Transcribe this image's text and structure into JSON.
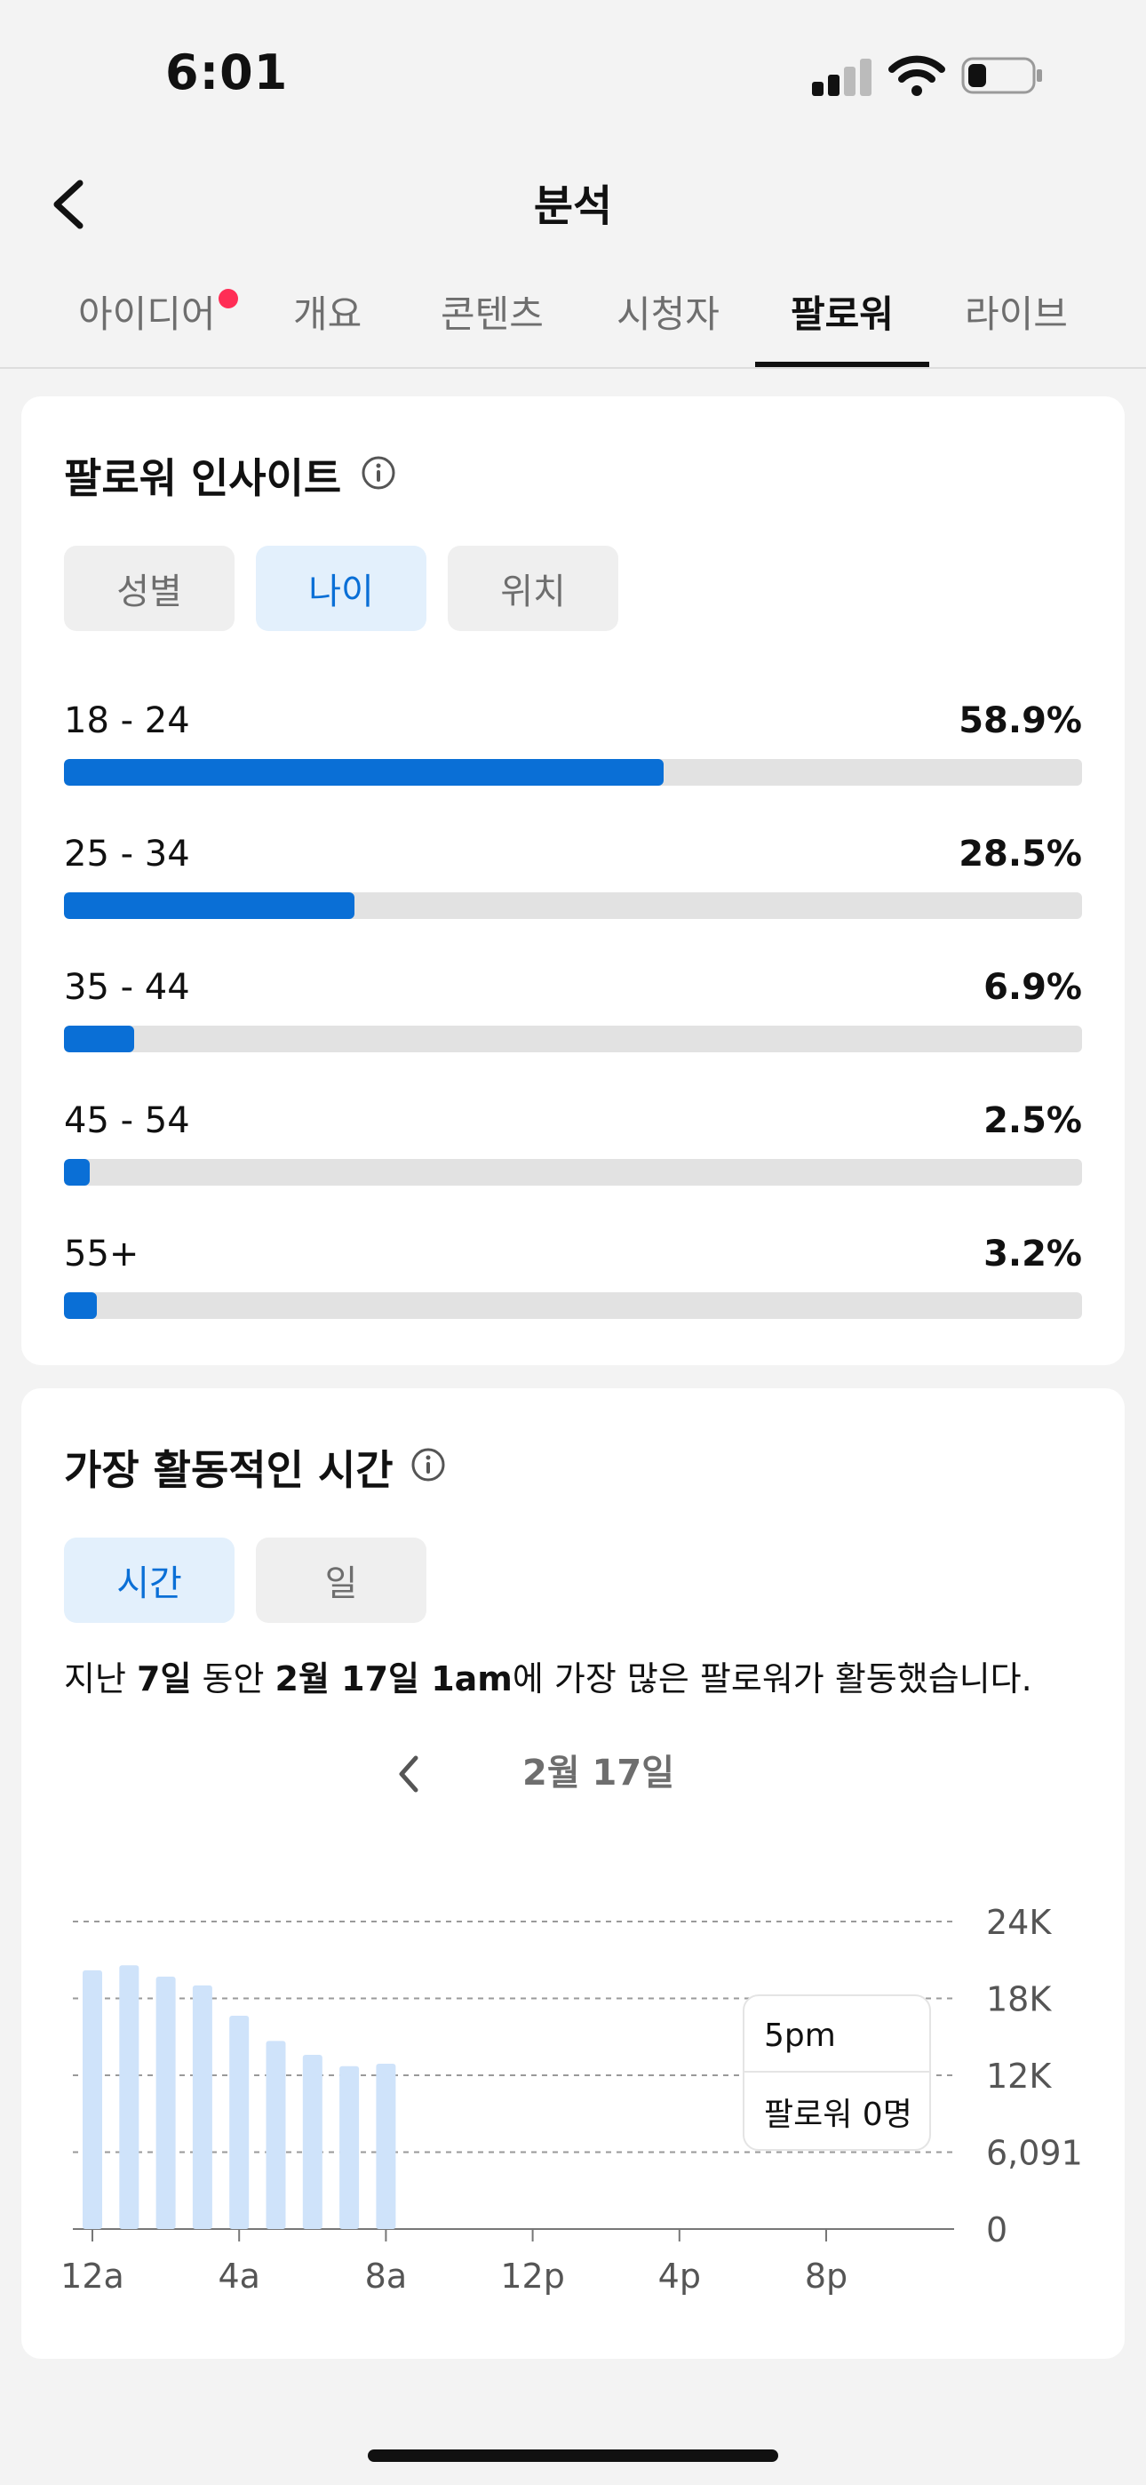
{
  "status_bar": {
    "time": "6:01"
  },
  "nav": {
    "title": "분석"
  },
  "tabs": [
    {
      "label": "아이디어",
      "active": false,
      "has_notification": true
    },
    {
      "label": "개요",
      "active": false
    },
    {
      "label": "콘텐츠",
      "active": false
    },
    {
      "label": "시청자",
      "active": false
    },
    {
      "label": "팔로워",
      "active": true
    },
    {
      "label": "라이브",
      "active": false
    }
  ],
  "follower_insights": {
    "title": "팔로워 인사이트",
    "filters": [
      {
        "label": "성별",
        "active": false
      },
      {
        "label": "나이",
        "active": true
      },
      {
        "label": "위치",
        "active": false
      }
    ],
    "age_groups": [
      {
        "label": "18 - 24",
        "percent": "58.9%",
        "fraction": 0.589
      },
      {
        "label": "25 - 34",
        "percent": "28.5%",
        "fraction": 0.285
      },
      {
        "label": "35 - 44",
        "percent": "6.9%",
        "fraction": 0.069
      },
      {
        "label": "45 - 54",
        "percent": "2.5%",
        "fraction": 0.025
      },
      {
        "label": "55+",
        "percent": "3.2%",
        "fraction": 0.032
      }
    ]
  },
  "active_times": {
    "title": "가장 활동적인 시간",
    "filters": [
      {
        "label": "시간",
        "active": true
      },
      {
        "label": "일",
        "active": false
      }
    ],
    "summary_prefix": "지난 ",
    "summary_days": "7일",
    "summary_mid": " 동안 ",
    "summary_date": "2월 17일 1am",
    "summary_suffix": "에 가장 많은 팔로워가 활동했습니다.",
    "date_label": "2월 17일",
    "tooltip": {
      "time": "5pm",
      "value": "팔로워 0명"
    }
  },
  "chart_data": {
    "type": "bar",
    "categories": [
      "12a",
      "1a",
      "2a",
      "3a",
      "4a",
      "5a",
      "6a",
      "7a",
      "8a",
      "9a",
      "10a",
      "11a",
      "12p",
      "1p",
      "2p",
      "3p",
      "4p",
      "5p",
      "6p",
      "7p",
      "8p",
      "9p",
      "10p",
      "11p"
    ],
    "x_tick_labels": [
      "12a",
      "4a",
      "8a",
      "12p",
      "4p",
      "8p"
    ],
    "values": [
      20500,
      20900,
      20000,
      19300,
      16900,
      14900,
      13800,
      12900,
      13100,
      0,
      0,
      0,
      0,
      0,
      0,
      0,
      0,
      0,
      0,
      0,
      0,
      0,
      0,
      0
    ],
    "y_tick_labels": [
      "24K",
      "18K",
      "12K",
      "6,091",
      "0"
    ],
    "y_ticks": [
      24364,
      18273,
      12182,
      6091,
      0
    ],
    "ylim": [
      0,
      24364
    ],
    "grid": true,
    "bar_color": "#cfe3fa"
  },
  "colors": {
    "accent": "#0a6fd6",
    "accent_light": "#e3f0fc",
    "track": "#e2e2e2",
    "notification": "#ff2d55"
  }
}
